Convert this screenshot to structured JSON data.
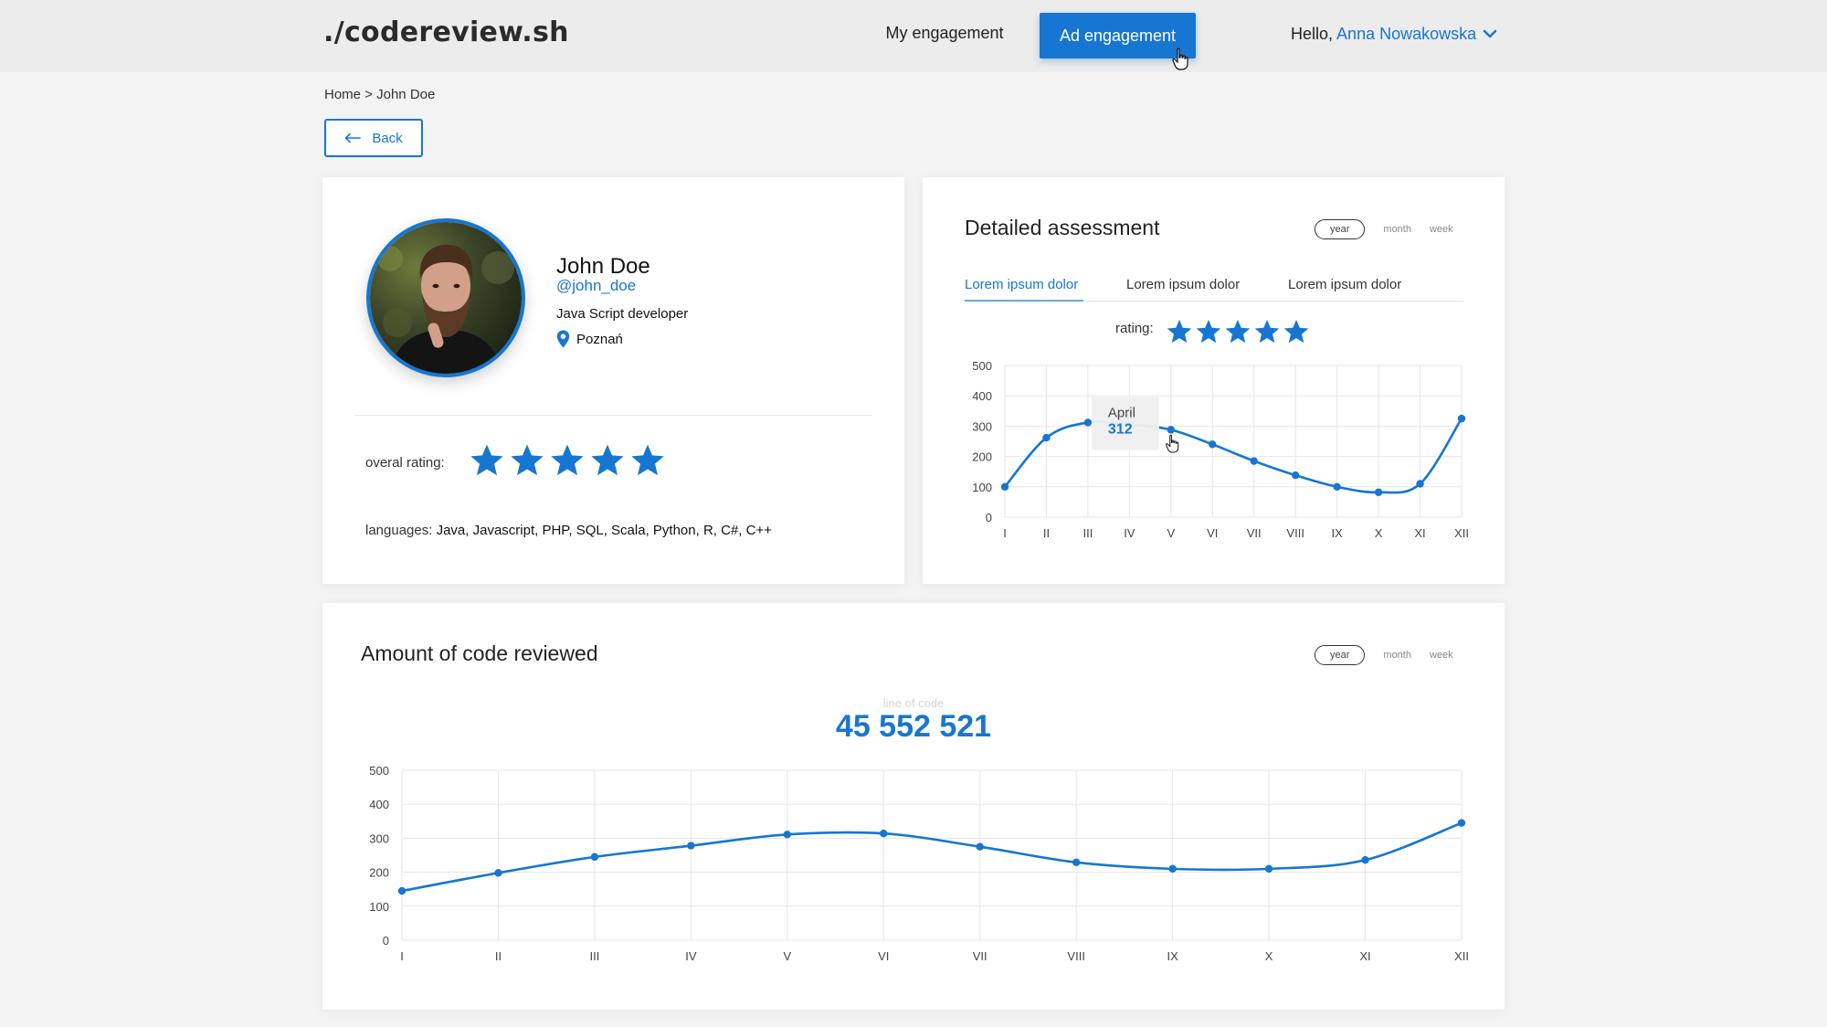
{
  "header": {
    "logo": "./codereview.sh",
    "nav": {
      "my_engagement": "My engagement",
      "ad_engagement": "Ad engagement"
    },
    "greeting": "Hello,",
    "user_name": "Anna Nowakowska"
  },
  "breadcrumb": {
    "home": "Home",
    "separator": ">",
    "current": "John Doe"
  },
  "back_label": "Back",
  "profile": {
    "name": "John Doe",
    "handle": "@john_doe",
    "role": "Java Script developer",
    "location": "Poznań",
    "rating_label": "overal rating:",
    "rating": 5,
    "languages_label": "languages:",
    "languages": "Java, Javascript, PHP, SQL, Scala, Python, R, C#, C++"
  },
  "assessment": {
    "title": "Detailed assessment",
    "periods": [
      "year",
      "month",
      "week"
    ],
    "selected_period": "year",
    "tabs": [
      "Lorem ipsum dolor",
      "Lorem ipsum dolor",
      "Lorem ipsum dolor"
    ],
    "rating_label": "rating:",
    "rating": 5,
    "tooltip": {
      "month": "April",
      "value": "312"
    }
  },
  "code_reviewed": {
    "title": "Amount of code reviewed",
    "periods": [
      "year",
      "month",
      "week"
    ],
    "selected_period": "year",
    "lines_label": "line of code",
    "lines_value": "45 552 521"
  },
  "chart_data": [
    {
      "type": "line",
      "name": "detailed-assessment",
      "categories": [
        "I",
        "II",
        "III",
        "IV",
        "V",
        "VI",
        "VII",
        "VIII",
        "IX",
        "X",
        "XI",
        "XII"
      ],
      "values": [
        100,
        262,
        312,
        306,
        288,
        240,
        185,
        138,
        100,
        82,
        110,
        325
      ],
      "yticks": [
        0,
        100,
        200,
        300,
        400,
        500
      ],
      "ylim": [
        0,
        500
      ],
      "grid": true,
      "color": "#1676d2"
    },
    {
      "type": "line",
      "name": "amount-of-code-reviewed",
      "categories": [
        "I",
        "II",
        "III",
        "IV",
        "V",
        "VI",
        "VII",
        "VIII",
        "IX",
        "X",
        "XI",
        "XII"
      ],
      "values": [
        145,
        198,
        245,
        278,
        311,
        314,
        275,
        229,
        210,
        210,
        236,
        345
      ],
      "yticks": [
        0,
        100,
        200,
        300,
        400,
        500
      ],
      "ylim": [
        0,
        500
      ],
      "grid": true,
      "color": "#1676d2"
    }
  ]
}
